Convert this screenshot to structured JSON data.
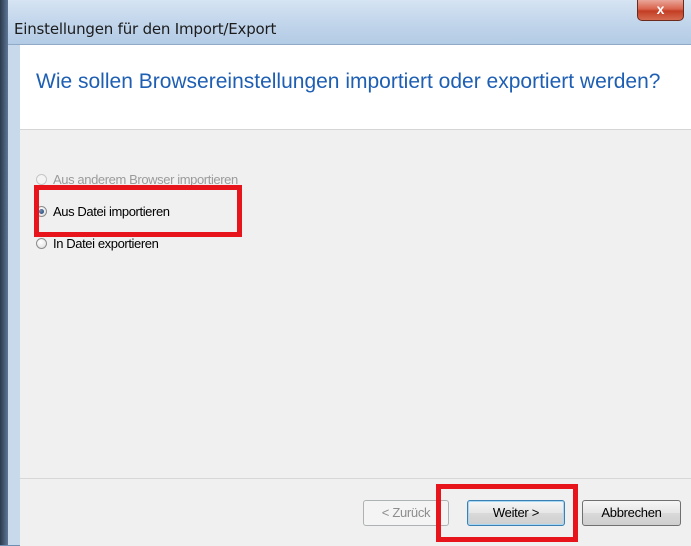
{
  "window": {
    "title": "Einstellungen für den Import/Export",
    "close_glyph": "x"
  },
  "header": {
    "title": "Wie sollen Browsereinstellungen importiert oder exportiert werden?"
  },
  "options": [
    {
      "label": "Aus anderem Browser importieren",
      "state": "disabled"
    },
    {
      "label": "Aus Datei importieren",
      "state": "selected"
    },
    {
      "label": "In Datei exportieren",
      "state": "unselected"
    }
  ],
  "buttons": {
    "back": "< Zurück",
    "next": "Weiter >",
    "cancel": "Abbrechen"
  },
  "colors": {
    "title_blue": "#1e5fb4",
    "highlight_red": "#e8141c"
  }
}
